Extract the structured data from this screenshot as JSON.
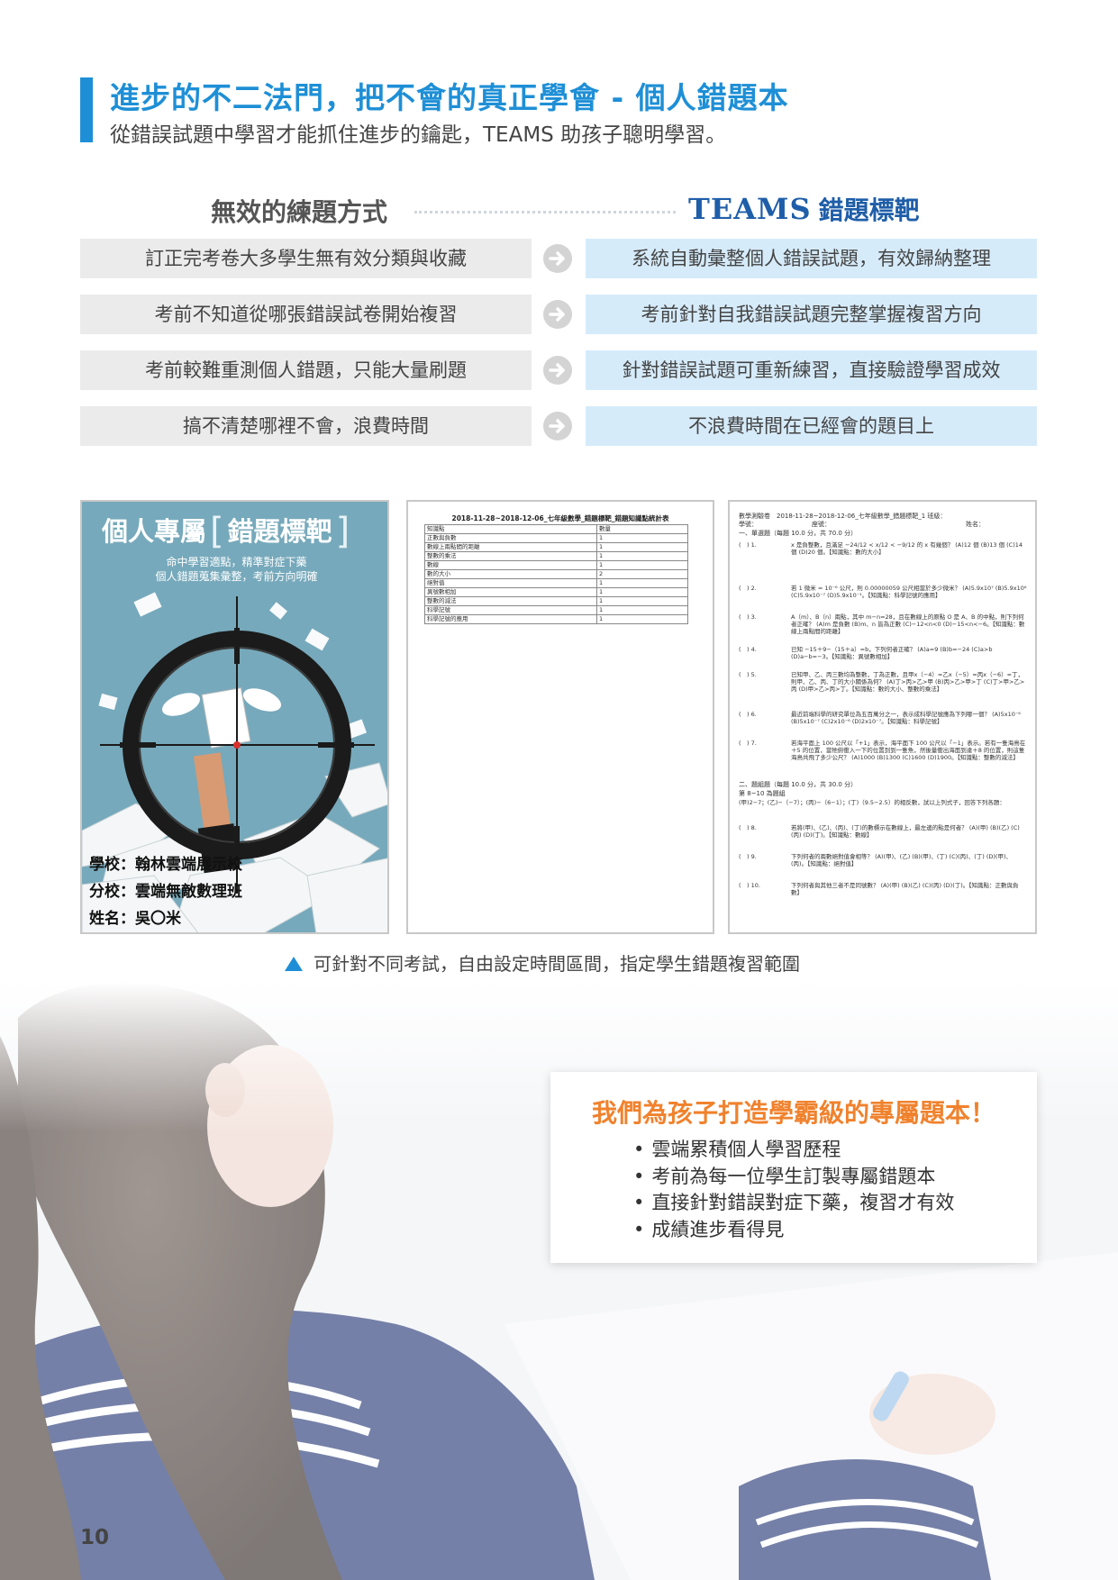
{
  "header": {
    "title": "進步的不二法門，把不會的真正學會 - 個人錯題本",
    "subtitle": "從錯誤試題中學習才能抓住進步的鑰匙，TEAMS 助孩子聰明學習。"
  },
  "comparison": {
    "left_heading": "無效的練題方式",
    "right_heading_brand": "TEAMS",
    "right_heading_rest": "錯題標靶",
    "rows": [
      {
        "left": "訂正完考卷大多學生無有效分類與收藏",
        "right": "系統自動彙整個人錯誤試題，有效歸納整理"
      },
      {
        "left": "考前不知道從哪張錯誤試卷開始複習",
        "right": "考前針對自我錯誤試題完整掌握複習方向"
      },
      {
        "left": "考前較難重測個人錯題，只能大量刷題",
        "right": "針對錯誤試題可重新練習，直接驗證學習成效"
      },
      {
        "left": "搞不清楚哪裡不會，浪費時間",
        "right": "不浪費時間在已經會的題目上"
      }
    ],
    "arrow_icon": "arrow-right-icon",
    "colors": {
      "left_bg": "#ebebeb",
      "right_bg": "#d6ebfa",
      "accent": "#1e8fd6",
      "brand": "#1f5ea8"
    }
  },
  "cover": {
    "title_left": "個人專屬",
    "title_right": "錯題標靶",
    "bracket_open": "[",
    "bracket_close": "]",
    "sub_line1": "命中學習適點，精準對症下藥",
    "sub_line2": "個人錯題蒐集彙整，考前方向明確",
    "school": "學校：翰林雲端展示校",
    "branch": "分校：雲端無敵數理班",
    "name": "姓名：吳〇米"
  },
  "stat_sheet": {
    "title": "2018-11-28~2018-12-06_七年級數學_錯題標靶_錯題知識點統計表",
    "header": [
      "知識點",
      "數量"
    ],
    "rows": [
      [
        "正數與負數",
        "1"
      ],
      [
        "數線上兩點間的距離",
        "1"
      ],
      [
        "整數的乘法",
        "1"
      ],
      [
        "數線",
        "1"
      ],
      [
        "數的大小",
        "2"
      ],
      [
        "絕對值",
        "1"
      ],
      [
        "異號數相加",
        "1"
      ],
      [
        "整數的減法",
        "1"
      ],
      [
        "科學記號",
        "1"
      ],
      [
        "科學記號的應用",
        "1"
      ]
    ]
  },
  "exam_sheet": {
    "header1": "數學測驗卷　2018-11-28~2018-12-06_七年級數學_錯題標靶_1 班級：",
    "header2_left": "學號：",
    "header2_mid": "座號：",
    "header2_right": "姓名：",
    "section1": "一、單選題（每題 10.0 分，共 70.0 分）",
    "questions1": [
      {
        "num": "(　) 1.",
        "text": "x 是負整數，且滿足 −24/12 < x/12 < −9/12 的 x 有幾個？ (A)12 個 (B)13 個 (C)14 個 (D)20 個。【知識點：數的大小】"
      },
      {
        "num": "(　) 2.",
        "text": "若 1 微米 = 10⁻⁶ 公尺，則 0.00000059 公尺相當於多少微米？ (A)5.9x10⁷ (B)5.9x10⁶ (C)5.9x10⁻⁷ (D)5.9x10⁻¹。【知識點：科學記號的應用】"
      },
      {
        "num": "(　) 3.",
        "text": "A（m）、B（n）兩點，其中 m−n=28，且在數線上的原點 O 是 A、B 的中點，則下列何者正確？ (A)m 是負數 (B)m、n 皆為正數 (C)−12<n<0 (D)−15<n<−6。【知識點：數線上兩點間的距離】"
      },
      {
        "num": "(　) 4.",
        "text": "已知 −15＋9−（15＋a）=b，下列何者正確？ (A)a=9 (B)b=−24 (C)a>b (D)a−b=−3。【知識點：異號數相加】"
      },
      {
        "num": "(　) 5.",
        "text": "已知甲、乙、丙三數均為整數，丁為正數，且甲x（−4）=乙x（−5）=丙x（−6）=丁，則甲、乙、丙、丁的大小關係為何？ (A)丁>丙>乙>甲 (B)丙>乙>甲>丁 (C)丁>甲>乙>丙 (D)甲>乙>丙>丁。【知識點：數的大小、整數的乘法】"
      },
      {
        "num": "(　) 6.",
        "text": "最近前端科學的研究單位為五百萬分之一，表示成科學記號應為下列哪一個？ (A)5x10⁻⁶ (B)5x10⁻⁷ (C)2x10⁻⁶ (D)2x10⁻⁷。【知識點：科學記號】"
      },
      {
        "num": "(　) 7.",
        "text": "若海平面上 100 公尺以「+1」表示，海平面下 100 公尺以「−1」表示。若有一隻海鳥在＋5 的位置，當牠俯衝入一下的位置到到一隻魚，然後量衝出海面到達＋8 的位置，則這隻海鳥共飛了多少公尺？ (A)1000 (B)1300 (C)1600 (D)1900。【知識點：整數的減法】"
      }
    ],
    "section2": "二、題組題（每題 10.0 分，共 30.0 分）",
    "section2_note": "第 8~10 為題組",
    "section2_desc": "(甲)2−7；(乙)−（−7）；(丙)−（6−1）；(丁)（9.5−2.5）的相反數，試以上列式子，回答下列各題：",
    "questions2": [
      {
        "num": "(　) 8.",
        "text": "若將(甲)、(乙)、(丙)、(丁)的數標示在數線上，最左邊的點是何者？ (A)(甲) (B)(乙) (C)(丙) (D)(丁)。【知識點：數線】"
      },
      {
        "num": "(　) 9.",
        "text": "下列何者的兩數絕對值會相等？ (A)(甲)、(乙) (B)(甲)、(丁) (C)(丙)、(丁) (D)(甲)、(丙)。【知識點：絕對值】"
      },
      {
        "num": "(　) 10.",
        "text": "下列何者與其他三者不是同號數？ (A)(甲) (B)(乙) (C)(丙) (D)(丁)。【知識點：正數與負數】"
      }
    ]
  },
  "caption": "可針對不同考試，自由設定時間區間，指定學生錯題複習範圍",
  "highlight": {
    "title": "我們為孩子打造學霸級的專屬題本！",
    "bullet": "•",
    "items": [
      "雲端累積個人學習歷程",
      "考前為每一位學生訂製專屬錯題本",
      "直接針對錯誤對症下藥，複習才有效",
      "成績進步看得見"
    ],
    "title_color": "#f0822d"
  },
  "page_number": "10"
}
